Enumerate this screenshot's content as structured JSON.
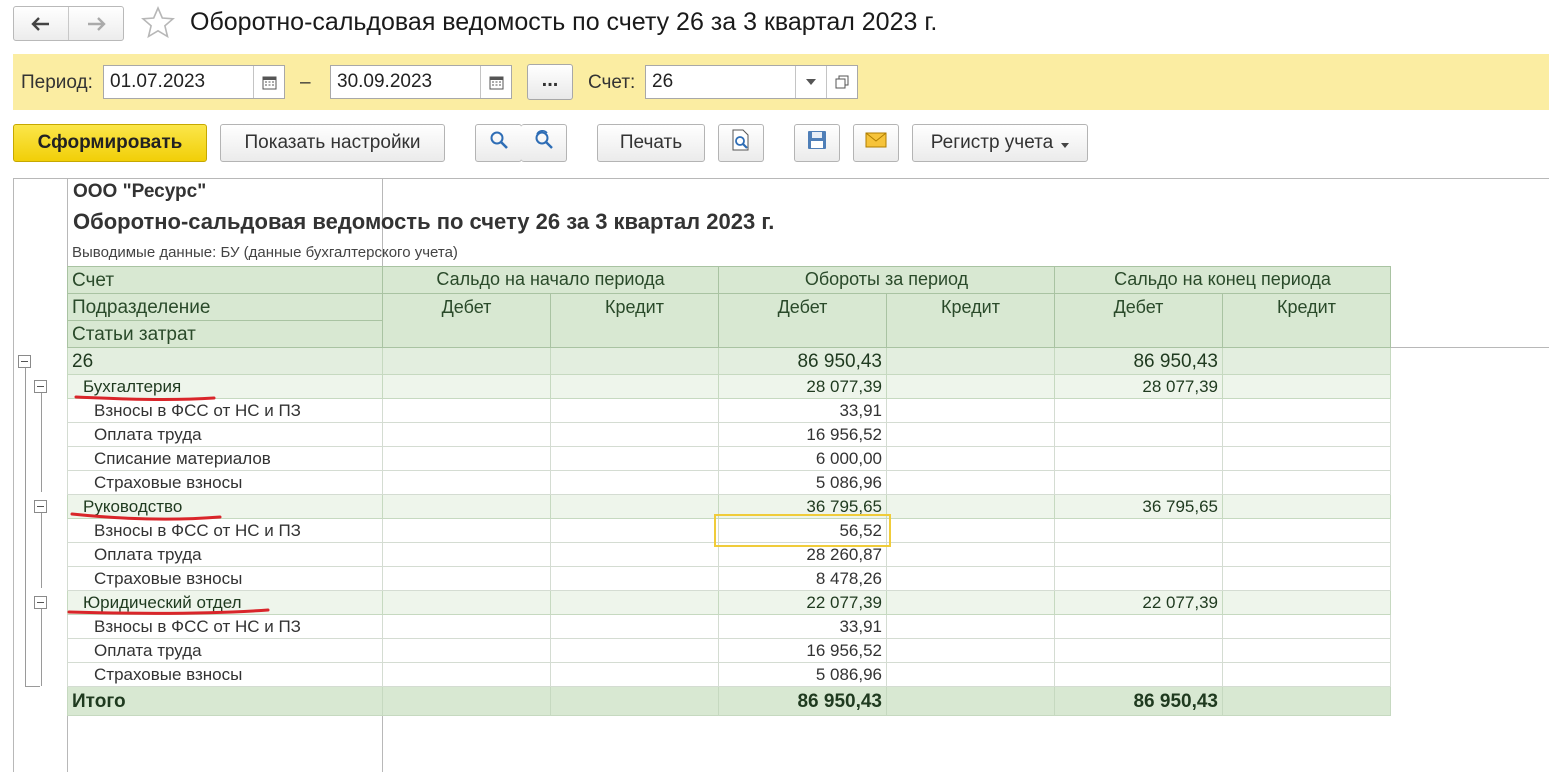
{
  "window": {
    "title": "Оборотно-сальдовая ведомость по счету 26 за 3 квартал 2023 г."
  },
  "filters": {
    "period_label": "Период:",
    "date_from": "01.07.2023",
    "dash": "–",
    "date_to": "30.09.2023",
    "more": "...",
    "account_label": "Счет:",
    "account_value": "26"
  },
  "toolbar": {
    "generate": "Сформировать",
    "show_settings": "Показать настройки",
    "print": "Печать",
    "register": "Регистр учета"
  },
  "report": {
    "org": "ООО \"Ресурс\"",
    "title": "Оборотно-сальдовая ведомость по счету 26 за 3 квартал 2023 г.",
    "subtitle": "Выводимые данные: БУ (данные бухгалтерского учета)",
    "header": {
      "account": "Счет",
      "department": "Подразделение",
      "cost_item": "Статьи затрат",
      "opening": "Сальдо на начало периода",
      "turnover": "Обороты за период",
      "closing": "Сальдо на конец периода",
      "debit": "Дебет",
      "credit": "Кредит"
    },
    "rows": [
      {
        "label": "26",
        "level": 0,
        "turnover_debit": "86 950,43",
        "closing_debit": "86 950,43"
      },
      {
        "label": "Бухгалтерия",
        "level": 1,
        "turnover_debit": "28 077,39",
        "closing_debit": "28 077,39"
      },
      {
        "label": "Взносы в ФСС от НС и ПЗ",
        "level": 2,
        "turnover_debit": "33,91",
        "closing_debit": ""
      },
      {
        "label": "Оплата труда",
        "level": 2,
        "turnover_debit": "16 956,52",
        "closing_debit": ""
      },
      {
        "label": "Списание материалов",
        "level": 2,
        "turnover_debit": "6 000,00",
        "closing_debit": ""
      },
      {
        "label": "Страховые взносы",
        "level": 2,
        "turnover_debit": "5 086,96",
        "closing_debit": ""
      },
      {
        "label": "Руководство",
        "level": 1,
        "turnover_debit": "36 795,65",
        "closing_debit": "36 795,65"
      },
      {
        "label": "Взносы в ФСС от НС и ПЗ",
        "level": 2,
        "turnover_debit": "56,52",
        "closing_debit": ""
      },
      {
        "label": "Оплата труда",
        "level": 2,
        "turnover_debit": "28 260,87",
        "closing_debit": ""
      },
      {
        "label": "Страховые взносы",
        "level": 2,
        "turnover_debit": "8 478,26",
        "closing_debit": ""
      },
      {
        "label": "Юридический отдел",
        "level": 1,
        "turnover_debit": "22 077,39",
        "closing_debit": "22 077,39"
      },
      {
        "label": "Взносы в ФСС от НС и ПЗ",
        "level": 2,
        "turnover_debit": "33,91",
        "closing_debit": ""
      },
      {
        "label": "Оплата труда",
        "level": 2,
        "turnover_debit": "16 956,52",
        "closing_debit": ""
      },
      {
        "label": "Страховые взносы",
        "level": 2,
        "turnover_debit": "5 086,96",
        "closing_debit": ""
      }
    ],
    "total": {
      "label": "Итого",
      "turnover_debit": "86 950,43",
      "closing_debit": "86 950,43"
    }
  },
  "colors": {
    "header_green": "#d8e8d2",
    "filter_yellow": "#fbeda2",
    "accent_yellow": "#f1cf08",
    "annotation_red": "#d9252a"
  }
}
